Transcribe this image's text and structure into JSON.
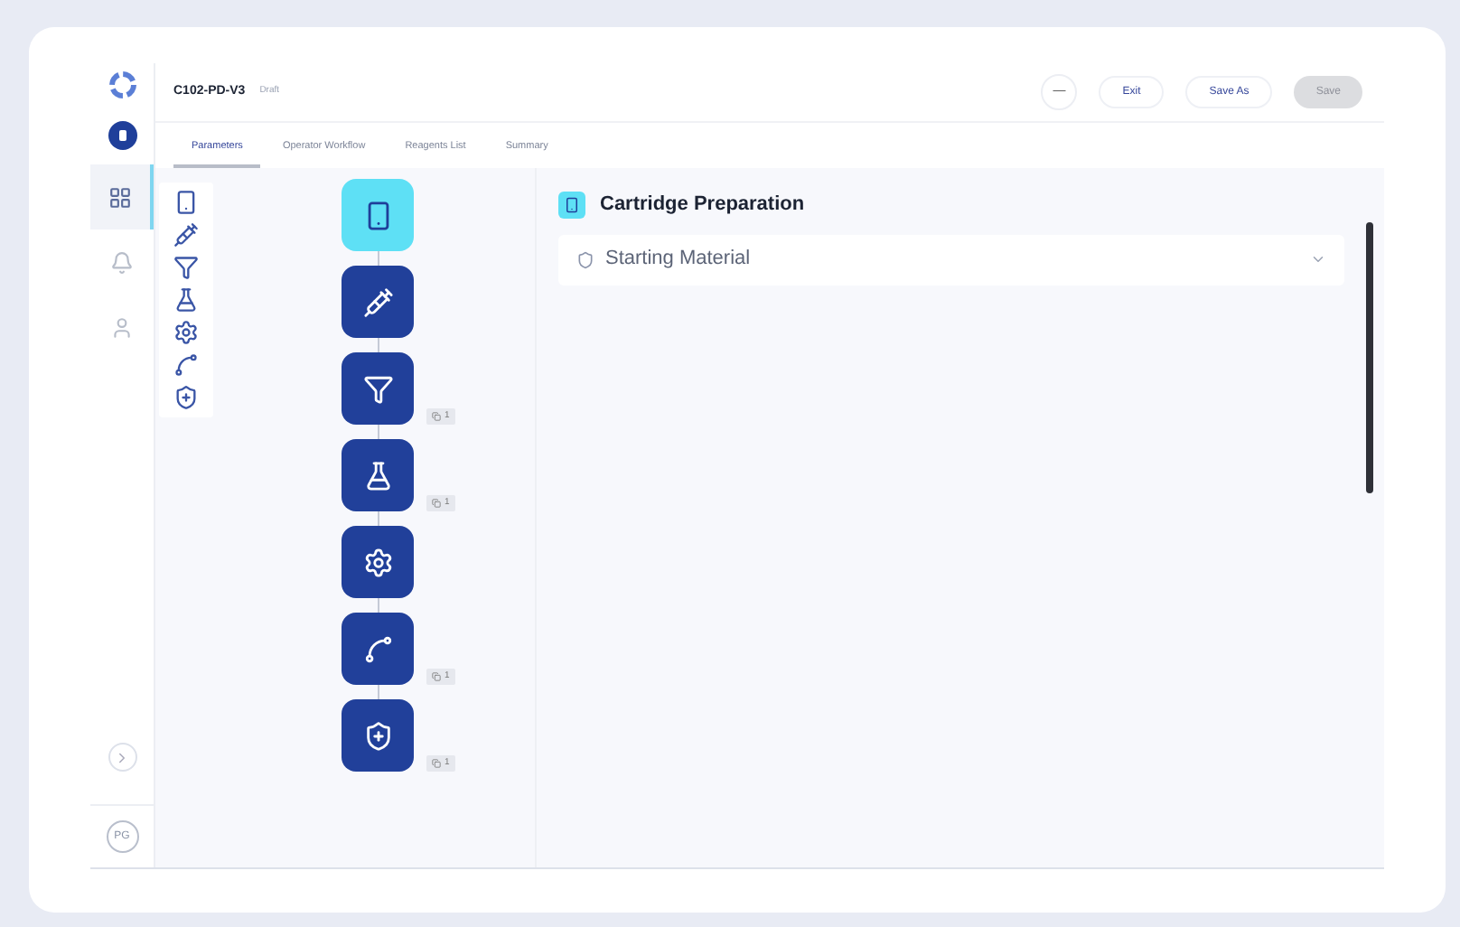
{
  "header": {
    "title": "C102-PD-V3",
    "status": "Draft",
    "buttons": [
      {
        "label": "—",
        "kind": "more",
        "disabled": false
      },
      {
        "label": "Exit",
        "kind": "plain",
        "disabled": false
      },
      {
        "label": "Save As",
        "kind": "plain",
        "disabled": false
      },
      {
        "label": "Save",
        "kind": "plain",
        "disabled": true
      }
    ]
  },
  "tabs": [
    {
      "label": "Parameters",
      "selected": true
    },
    {
      "label": "Operator Workflow",
      "selected": false
    },
    {
      "label": "Reagents List",
      "selected": false
    },
    {
      "label": "Summary",
      "selected": false
    }
  ],
  "rail": {
    "items": [
      {
        "kind": "grid",
        "selected": true
      },
      {
        "kind": "bell",
        "selected": false
      },
      {
        "kind": "user",
        "selected": false
      }
    ],
    "avatar": "PG"
  },
  "steps": [
    {
      "kind": "cartridge",
      "selected": true
    },
    {
      "kind": "syringe",
      "selected": false
    },
    {
      "kind": "filter",
      "selected": false,
      "badge": "1"
    },
    {
      "kind": "flask",
      "selected": false,
      "badge": "1"
    },
    {
      "kind": "gear",
      "selected": false
    },
    {
      "kind": "curve",
      "selected": false,
      "badge": "1"
    },
    {
      "kind": "shield",
      "selected": false,
      "badge": "1"
    }
  ],
  "panel": {
    "title": "Cartridge Preparation",
    "section": {
      "label": "Starting Material",
      "expanded": false
    }
  }
}
